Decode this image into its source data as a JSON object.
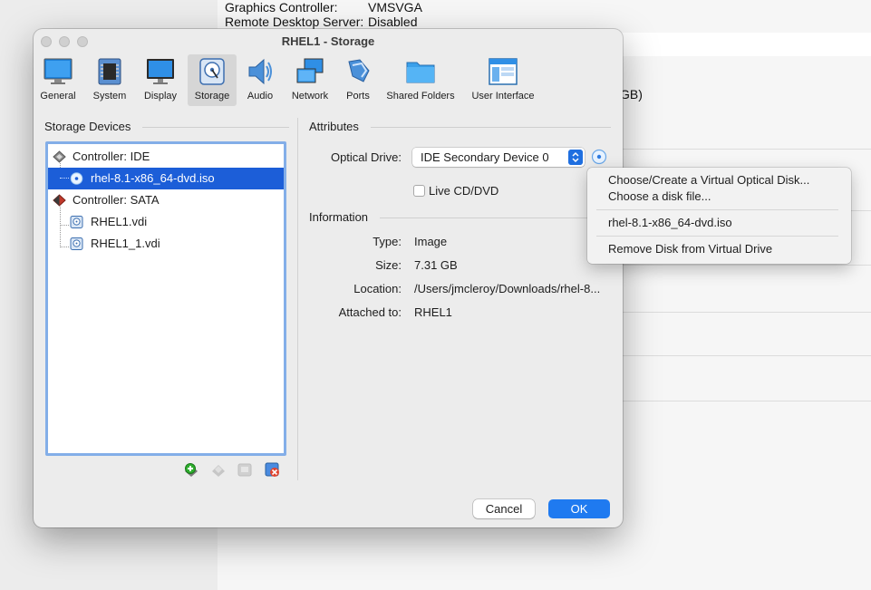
{
  "background": {
    "rows": [
      {
        "key": "Graphics Controller:",
        "value": "VMSVGA"
      },
      {
        "key": "Remote Desktop Server:",
        "value": "Disabled"
      }
    ],
    "partial_text": "GB)"
  },
  "dialog": {
    "title": "RHEL1 - Storage",
    "toolbar": [
      {
        "label": "General",
        "icon": "monitor-icon"
      },
      {
        "label": "System",
        "icon": "chip-icon"
      },
      {
        "label": "Display",
        "icon": "display-icon"
      },
      {
        "label": "Storage",
        "icon": "hard-disk-icon",
        "active": true
      },
      {
        "label": "Audio",
        "icon": "speaker-icon"
      },
      {
        "label": "Network",
        "icon": "network-icon"
      },
      {
        "label": "Ports",
        "icon": "ports-icon"
      },
      {
        "label": "Shared Folders",
        "icon": "folder-icon"
      },
      {
        "label": "User Interface",
        "icon": "window-icon"
      }
    ],
    "storage_devices": {
      "heading": "Storage Devices",
      "tree": [
        {
          "label": "Controller: IDE",
          "type": "controller"
        },
        {
          "label": "rhel-8.1-x86_64-dvd.iso",
          "type": "optical",
          "selected": true
        },
        {
          "label": "Controller: SATA",
          "type": "controller"
        },
        {
          "label": "RHEL1.vdi",
          "type": "disk"
        },
        {
          "label": "RHEL1_1.vdi",
          "type": "disk"
        }
      ]
    },
    "attributes": {
      "heading": "Attributes",
      "optical_drive_label": "Optical Drive:",
      "optical_drive_value": "IDE Secondary Device 0",
      "live_cd_label": "Live CD/DVD",
      "live_cd_checked": false
    },
    "information": {
      "heading": "Information",
      "rows": [
        {
          "label": "Type:",
          "value": "Image"
        },
        {
          "label": "Size:",
          "value": "7.31 GB"
        },
        {
          "label": "Location:",
          "value": "/Users/jmcleroy/Downloads/rhel-8..."
        },
        {
          "label": "Attached to:",
          "value": "RHEL1"
        }
      ]
    },
    "buttons": {
      "cancel": "Cancel",
      "ok": "OK"
    }
  },
  "menu": {
    "items": [
      "Choose/Create a Virtual Optical Disk...",
      "Choose a disk file...",
      "rhel-8.1-x86_64-dvd.iso",
      "Remove Disk from Virtual Drive"
    ]
  },
  "colors": {
    "accent": "#1f7af0",
    "selection": "#1c5ed8",
    "tree_border": "#83aee8"
  }
}
